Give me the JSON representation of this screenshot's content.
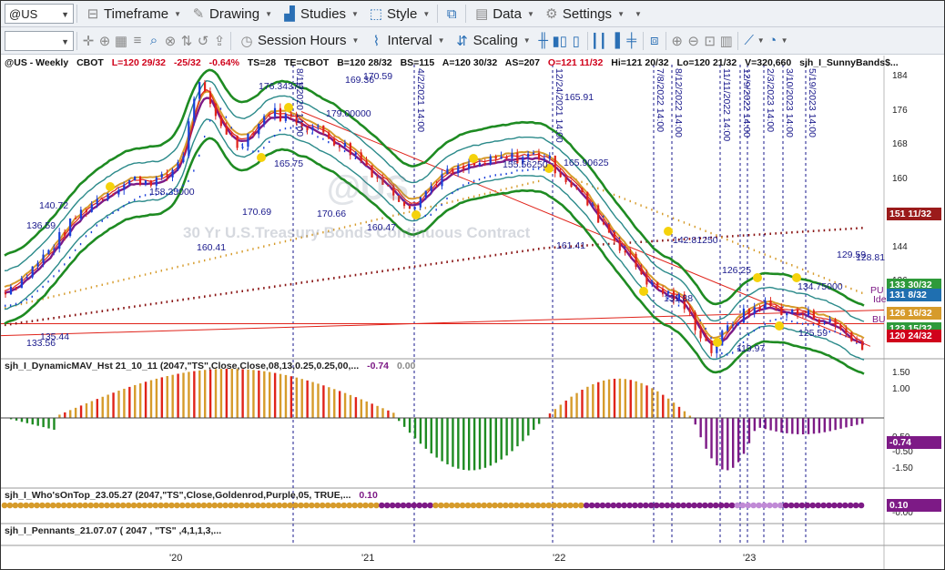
{
  "toolbar1": {
    "symbol": "@US",
    "timeframe": "Timeframe",
    "drawing": "Drawing",
    "studies": "Studies",
    "style": "Style",
    "data": "Data",
    "settings": "Settings"
  },
  "toolbar2": {
    "combo_value": "",
    "session_hours": "Session Hours",
    "interval": "Interval",
    "scaling": "Scaling"
  },
  "header": {
    "symbol": "@US - Weekly",
    "exchange": "CBOT",
    "last": "L=120 29/32",
    "change": "-25/32",
    "pct": "-0.64%",
    "ts": "TS=28",
    "te": "TE=CBOT",
    "bid": "B=120 28/32",
    "bs": "BS=115",
    "ask": "A=120 30/32",
    "as": "AS=207",
    "open": "O=121 11/32",
    "high": "Hi=121 20/32",
    "low": "Lo=120 21/32",
    "vol": "V=320,660",
    "study": "sjh_I_SunnyBands$..."
  },
  "watermark": {
    "big": "@US",
    "small": "30 Yr U.S.Treasury Bonds Continuous Contract"
  },
  "price_axis": [
    "184",
    "176",
    "168",
    "160",
    "152",
    "144",
    "136",
    "128"
  ],
  "price_tags": [
    {
      "label": "151 11/32",
      "color": "#9b1b1b"
    },
    {
      "label": "133 30/32",
      "color": "#2e9a3a"
    },
    {
      "label": "131 8/32",
      "color": "#1f6fb0"
    },
    {
      "label": "126 16/32",
      "color": "#d69b2b"
    },
    {
      "label": "123 15/32",
      "color": "#2e9a3a"
    },
    {
      "label": "120 24/32",
      "color": "#d0021b"
    }
  ],
  "annotations": [
    "176.34375",
    "170.59",
    "169.36",
    "165.91",
    "179.00000",
    "165.75",
    "158.25000",
    "170.69",
    "170.66",
    "160.41",
    "160.47",
    "161.41",
    "140.72",
    "136.59",
    "155.56250",
    "165.90625",
    "142.81250",
    "126.25",
    "131.88",
    "129.59",
    "128.81",
    "134.75000",
    "135.44",
    "133.56",
    "119.97",
    "125.59"
  ],
  "vertical_labels": [
    "8/11/2020 14:00",
    "4/2/2021 14:00",
    "12/24/2021 14:00",
    "7/8/2022 14:00",
    "8/12/2022 14:00",
    "11/11/2022 14:00",
    "12/9/2022 14:00",
    "2/3/2023 14:00",
    "3/10/2023 14:00",
    "5/19/2023 14:00"
  ],
  "side_labels": [
    "Ide",
    "PU",
    "BU"
  ],
  "panel_dynmav": {
    "title": "sjh_I_DynamicMAV_Hst 21_10_11 (2047,\"TS\",Close,Close,08,13,0.25,0.25,00,...",
    "v1": "-0.74",
    "v2": "0.00",
    "axis": [
      "1.50",
      "1.00",
      "0.50",
      "-0.50",
      "-1.00",
      "-1.50"
    ],
    "tag": "-0.74",
    "tag_color": "#7d1a86"
  },
  "panel_whos": {
    "title": "sjh_I_Who'sOnTop_23.05.27 (2047,\"TS\",Close,Goldenrod,Purple,05,  TRUE,...",
    "v1": "0.10",
    "axis": [
      "-0.00"
    ],
    "tag": "0.10",
    "tag_color": "#7d1a86"
  },
  "panel_pennants": {
    "title": "sjh_I_Pennants_21.07.07 ( 2047 , \"TS\" ,4,1,1,3,..."
  },
  "x_axis": [
    "'20",
    "'21",
    "'22",
    "'23"
  ],
  "colors": {
    "bull": "#1a3fd9",
    "bear": "#e0231a",
    "green_band": "#1e8b22",
    "teal_band": "#2b8a8a",
    "gold": "#d69b2b",
    "purple": "#7d1a86",
    "maroon": "#8a1515"
  }
}
